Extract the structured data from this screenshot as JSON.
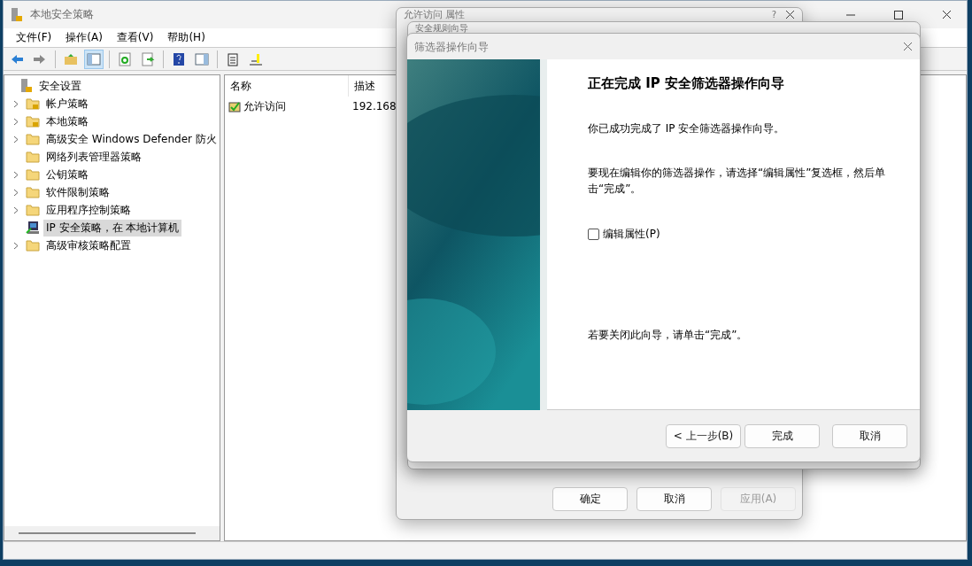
{
  "main_window": {
    "title": "本地安全策略",
    "menu": [
      "文件(F)",
      "操作(A)",
      "查看(V)",
      "帮助(H)"
    ],
    "tree": {
      "label": "安全设置",
      "children": [
        {
          "label": "帐户策略",
          "kind": "locked-folder",
          "expandable": true,
          "selected": false
        },
        {
          "label": "本地策略",
          "kind": "locked-folder",
          "expandable": true,
          "selected": false
        },
        {
          "label": "高级安全 Windows Defender 防火",
          "kind": "folder",
          "expandable": true,
          "selected": false
        },
        {
          "label": "网络列表管理器策略",
          "kind": "folder",
          "expandable": false,
          "selected": false
        },
        {
          "label": "公钥策略",
          "kind": "folder",
          "expandable": true,
          "selected": false
        },
        {
          "label": "软件限制策略",
          "kind": "folder",
          "expandable": true,
          "selected": false
        },
        {
          "label": "应用程序控制策略",
          "kind": "folder",
          "expandable": true,
          "selected": false
        },
        {
          "label": "IP 安全策略，在 本地计算机",
          "kind": "computer",
          "expandable": false,
          "selected": true
        },
        {
          "label": "高级审核策略配置",
          "kind": "folder",
          "expandable": true,
          "selected": false
        }
      ]
    },
    "list": {
      "columns": [
        "名称",
        "描述"
      ],
      "rows": [
        {
          "name": "允许访问",
          "description": "192.168"
        }
      ]
    }
  },
  "properties_dialog": {
    "title": "允许访问 属性",
    "help_glyph": "?",
    "buttons": [
      {
        "label": "确定",
        "disabled": false
      },
      {
        "label": "取消",
        "disabled": false
      },
      {
        "label": "应用(A)",
        "disabled": true
      }
    ]
  },
  "rule_wizard": {
    "title": "安全规则向导"
  },
  "filter_wizard": {
    "title": "筛选器操作向导",
    "heading": "正在完成 IP 安全筛选器操作向导",
    "paragraphs": [
      "你已成功完成了 IP 安全筛选器操作向导。",
      "要现在编辑你的筛选器操作，请选择“编辑属性”复选框，然后单击“完成”。"
    ],
    "checkbox": {
      "label": "编辑属性(P)",
      "checked": false
    },
    "closing": "若要关闭此向导，请单击“完成”。",
    "buttons": [
      {
        "label": "< 上一步(B)",
        "selected": false
      },
      {
        "label": "完成",
        "selected": false
      },
      {
        "label": "取消",
        "selected": false
      }
    ]
  }
}
